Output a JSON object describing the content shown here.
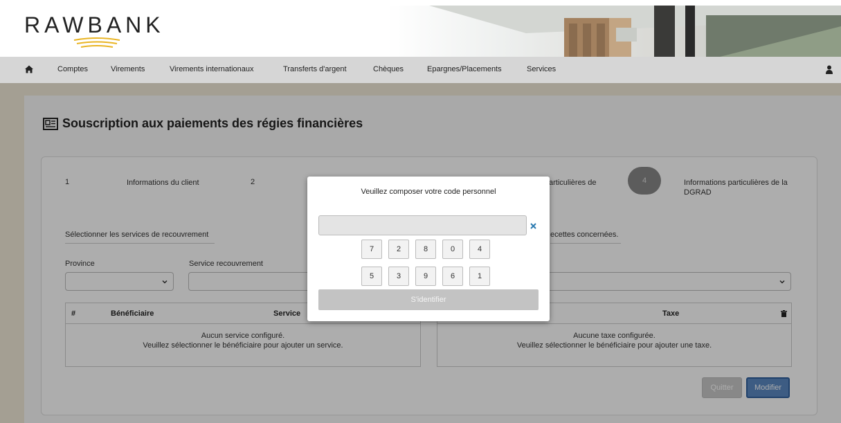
{
  "brand": {
    "name": "RAWBANK"
  },
  "nav": {
    "items": [
      "Comptes",
      "Virements",
      "Virements internationaux",
      "Transferts d'argent",
      "Chèques",
      "Epargnes/Placements",
      "Services"
    ]
  },
  "page": {
    "title": "Souscription aux paiements des régies financières"
  },
  "steps": {
    "s1_num": "1",
    "s1_label": "Informations du client",
    "s2_num": "2",
    "s3_label": "articulières de",
    "s4_num": "4",
    "s4_label": "Informations particulières de la DGRAD"
  },
  "form": {
    "section_left": "Sélectionner les services de recouvrement",
    "section_right": "ecettes concernées.",
    "province_label": "Province",
    "service_label": "Service recouvrement"
  },
  "table_left": {
    "col_hash": "#",
    "col_beneficiaire": "Bénéficiaire",
    "col_service": "Service",
    "empty_line1": "Aucun service configuré.",
    "empty_line2": "Veuillez sélectionner le bénéficiaire pour ajouter un service."
  },
  "table_right": {
    "col_taxe": "Taxe",
    "empty_line1": "Aucune taxe configurée.",
    "empty_line2": "Veuillez sélectionner le bénéficiaire pour ajouter une taxe."
  },
  "buttons": {
    "quit": "Quitter",
    "modify": "Modifier"
  },
  "modal": {
    "title": "Veuillez composer votre code personnel",
    "keys_row1": [
      "7",
      "2",
      "8",
      "0",
      "4"
    ],
    "keys_row2": [
      "5",
      "3",
      "9",
      "6",
      "1"
    ],
    "login": "S'identifier"
  },
  "colors": {
    "nav_bg": "#d6d6d6",
    "accent_blue": "#2e5f9c",
    "logo_gold": "#e9b422",
    "page_bg": "#f2ead9"
  }
}
